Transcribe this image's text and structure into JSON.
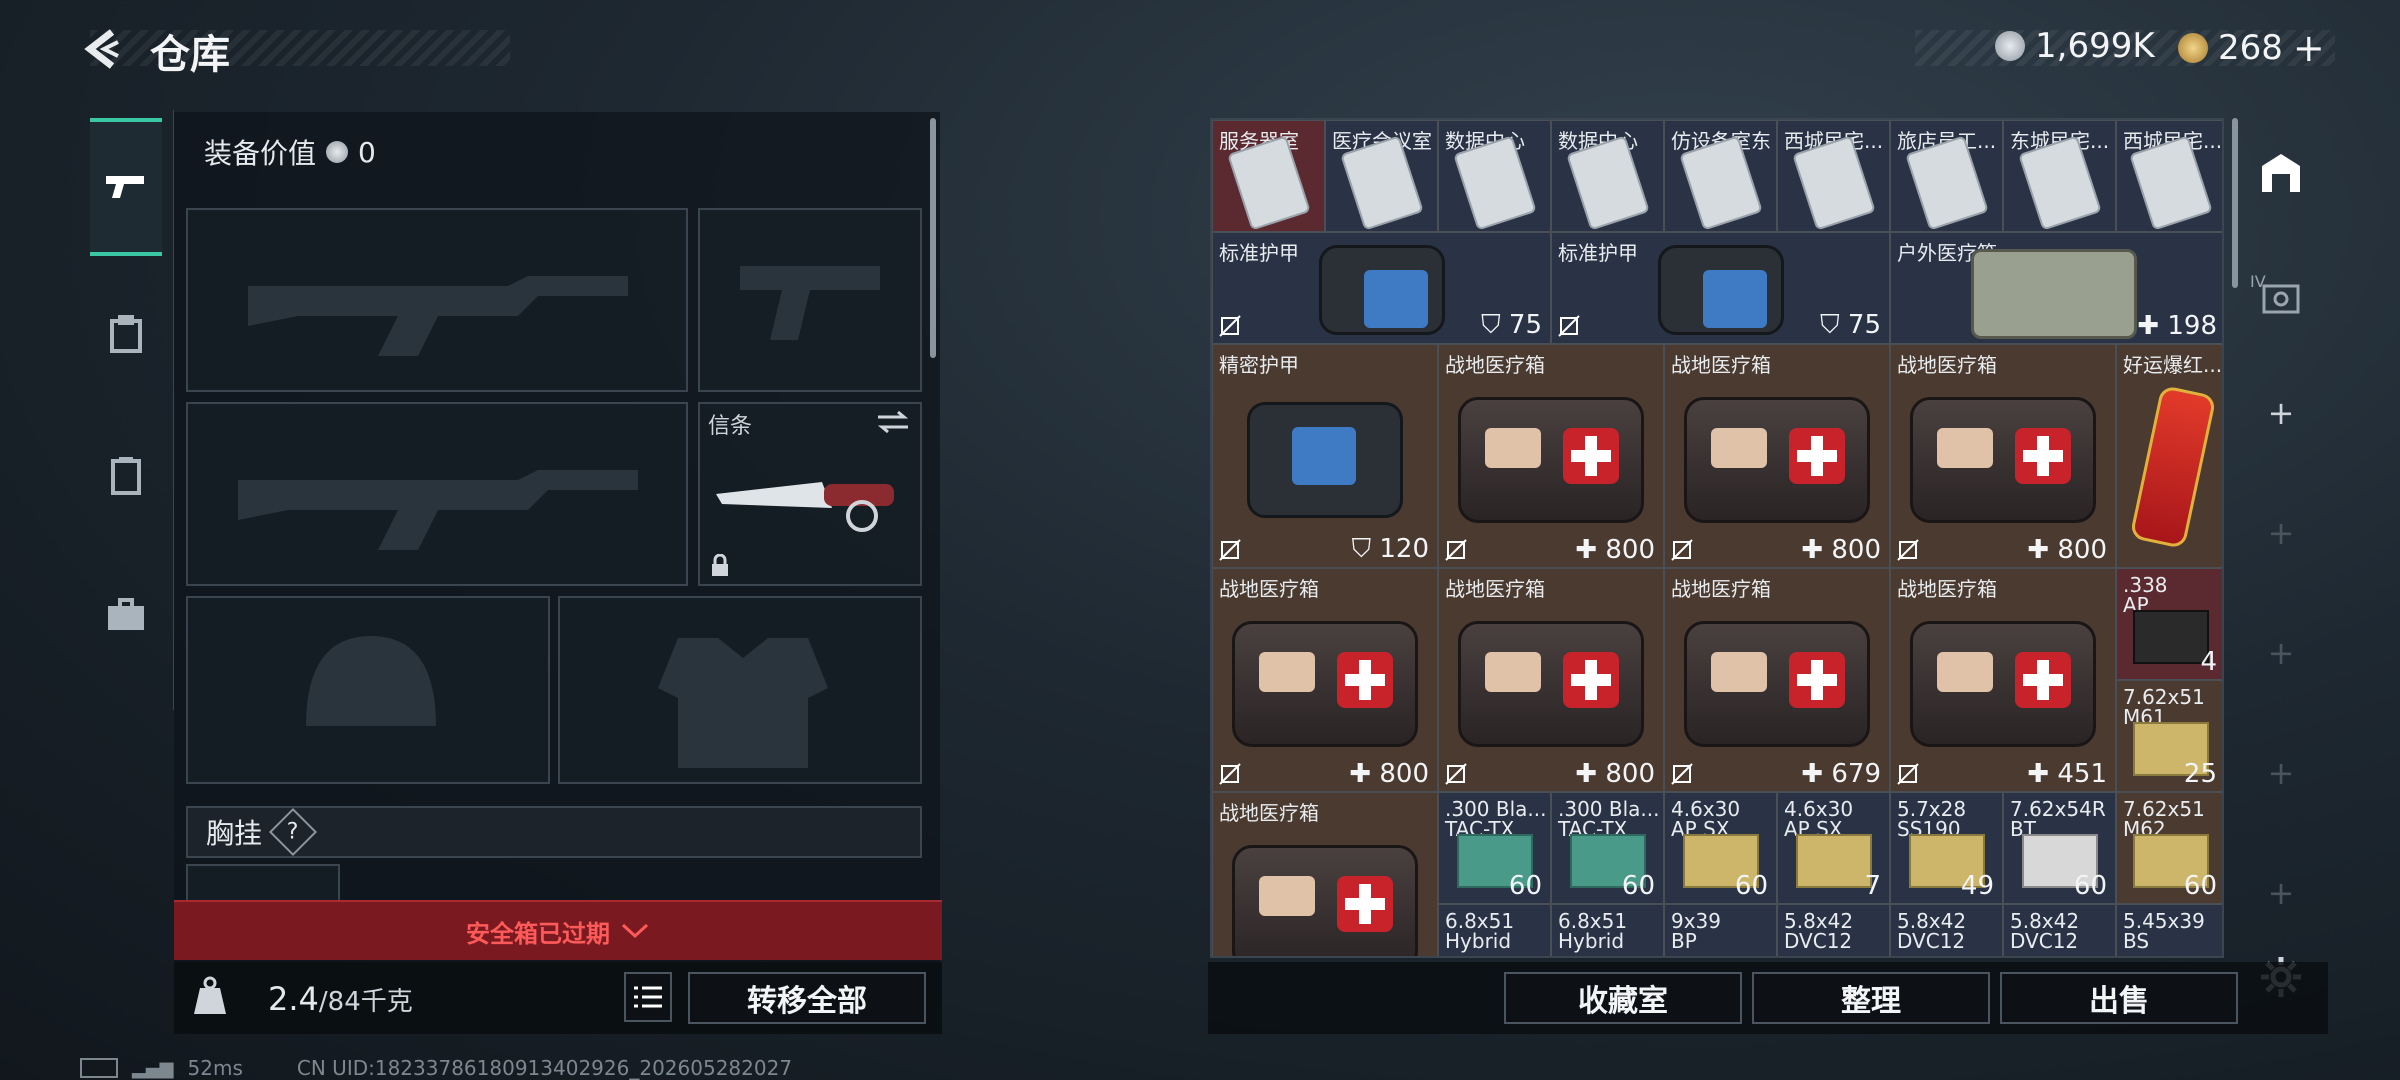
{
  "header": {
    "title": "仓库"
  },
  "currency": {
    "coins": "1,699K",
    "tokens": "268",
    "plus": "+"
  },
  "loadout": {
    "value_label": "装备价值",
    "value": "0",
    "knife_label": "信条",
    "chest_label": "胸挂",
    "chest_help": "?",
    "safe_box_expired": "安全箱已过期",
    "weight_current": "2.4",
    "weight_max": "/84千克",
    "transfer_all": "转移全部"
  },
  "grid": {
    "row1": [
      "服务器室",
      "医疗会议室",
      "数据中心",
      "数据中心",
      "仿设备室东",
      "西城民宅...",
      "旅店员工...",
      "东城民宅...",
      "西城民宅..."
    ],
    "armor1": {
      "name": "标准护甲",
      "value": "75"
    },
    "armor2": {
      "name": "标准护甲",
      "value": "75"
    },
    "outdoor_kit": {
      "name": "户外医疗箱",
      "value": "198"
    },
    "precise_armor": {
      "name": "精密护甲",
      "value": "120"
    },
    "field_kit": "战地医疗箱",
    "field_values_r3": [
      "800",
      "800",
      "800"
    ],
    "lucky": "好运爆红...",
    "field_values_r4": [
      "800",
      "800",
      "679",
      "451"
    ],
    "ammo_338": {
      "name": ".338",
      "sub": "AP",
      "count": "4"
    },
    "ammo_762m": {
      "name": "7.62x51",
      "sub": "M61",
      "count": "25"
    },
    "ammo_r5": [
      {
        "name": ".300 Bla...",
        "sub": "TAC-TX",
        "count": "60"
      },
      {
        "name": ".300 Bla...",
        "sub": "TAC-TX",
        "count": "60"
      },
      {
        "name": "4.6x30",
        "sub": "AP SX",
        "count": "60"
      },
      {
        "name": "4.6x30",
        "sub": "AP SX",
        "count": "7"
      },
      {
        "name": "5.7x28",
        "sub": "SS190",
        "count": "49"
      },
      {
        "name": "7.62x54R",
        "sub": "BT",
        "count": "60"
      },
      {
        "name": "7.62x51",
        "sub": "M62",
        "count": "60"
      }
    ],
    "ammo_r6": [
      {
        "name": "6.8x51",
        "sub": "Hybrid"
      },
      {
        "name": "6.8x51",
        "sub": "Hybrid"
      },
      {
        "name": "9x39",
        "sub": "BP"
      },
      {
        "name": "5.8x42",
        "sub": "DVC12"
      },
      {
        "name": "5.8x42",
        "sub": "DVC12"
      },
      {
        "name": "5.8x42",
        "sub": "DVC12"
      },
      {
        "name": "5.45x39",
        "sub": "BS"
      }
    ]
  },
  "sidebar_right": {
    "tier_label": "IV"
  },
  "actions": {
    "collection": "收藏室",
    "sort": "整理",
    "sell": "出售"
  },
  "status": {
    "ping": "52ms",
    "uid": "CN UID:18233786180913402926_202605282027"
  },
  "colors": {
    "accent": "#39c7a4",
    "expired": "#7a1a20"
  }
}
